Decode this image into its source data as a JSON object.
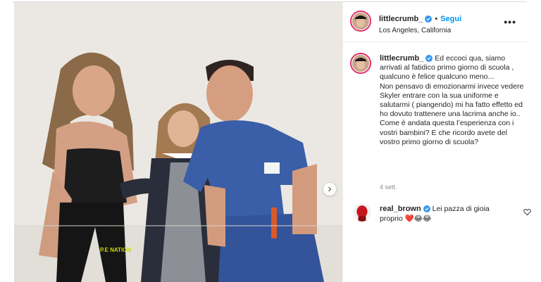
{
  "post": {
    "author": "littlecrumb_",
    "separator": "•",
    "follow_label": "Segui",
    "location": "Los Angeles, California",
    "more_label": "•••",
    "caption": [
      "Ed eccoci qua, siamo arrivati al fatidico primo giorno di scuola , qualcuno è felice qualcuno meno...",
      "Non pensavo di emozionarmi invece vedere Skyler entrare con la sua uniforme e salutarmi ( piangendo) mi ha fatto effetto ed ho dovuto trattenere una lacrima anche io..",
      "Come è andata questa l’esperienza con i vostri bambini? E che ricordo avete del vostro primo giorno di scuola?"
    ],
    "timestamp": "4 sett."
  },
  "comment": {
    "author": "real_brown",
    "text": "Lei pazza di gioia proprio",
    "emojis": "❤️😂😂"
  },
  "colors": {
    "accent": "#0095f6",
    "verified": "#3897f0",
    "ring": "#e1306c",
    "background": "#ffffff"
  },
  "icons": {
    "verified": "verified-badge-icon",
    "more": "more-options-icon",
    "next": "chevron-right-icon",
    "like": "heart-outline-icon"
  }
}
